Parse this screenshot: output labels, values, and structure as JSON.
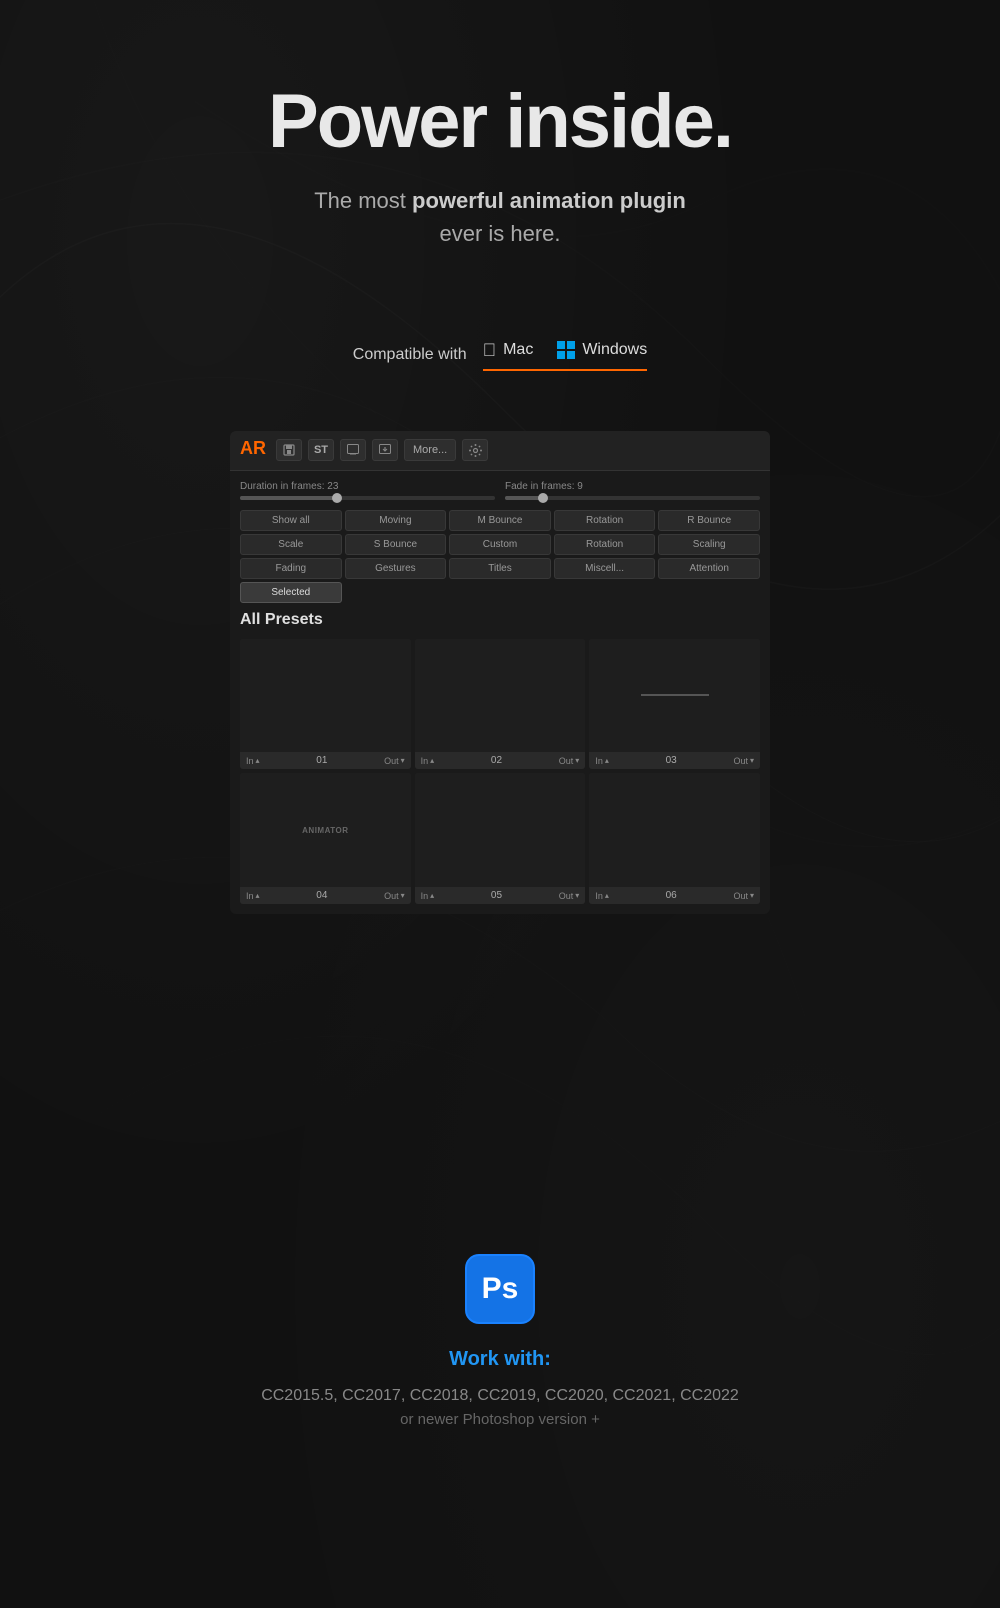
{
  "hero": {
    "title": "Power inside.",
    "subtitle_line1": "The most",
    "subtitle_bold": "powerful animation plugin",
    "subtitle_line2": "ever is here."
  },
  "compatible": {
    "label": "Compatible with",
    "mac": "Mac",
    "windows": "Windows"
  },
  "panel": {
    "toolbar": {
      "logo_text": "AR",
      "btn_st": "ST",
      "btn_more": "More...",
      "btn_gear": "⚙"
    },
    "duration_label": "Duration in frames: 23",
    "fade_label": "Fade in frames: 9",
    "duration_value": 23,
    "duration_max": 60,
    "fade_value": 9,
    "fade_max": 60,
    "filters": [
      {
        "label": "Show all",
        "active": false
      },
      {
        "label": "Moving",
        "active": false
      },
      {
        "label": "M Bounce",
        "active": false
      },
      {
        "label": "Rotation",
        "active": false
      },
      {
        "label": "R Bounce",
        "active": false
      },
      {
        "label": "Scale",
        "active": false
      },
      {
        "label": "S Bounce",
        "active": false
      },
      {
        "label": "Custom",
        "active": false
      },
      {
        "label": "Rotation",
        "active": false
      },
      {
        "label": "Scaling",
        "active": false
      },
      {
        "label": "Fading",
        "active": false
      },
      {
        "label": "Gestures",
        "active": false
      },
      {
        "label": "Titles",
        "active": false
      },
      {
        "label": "Miscell...",
        "active": false
      },
      {
        "label": "Attention",
        "active": false
      },
      {
        "label": "Selected",
        "active": true
      }
    ],
    "section_title": "All Presets",
    "presets": [
      {
        "number": "01",
        "has_line": false
      },
      {
        "number": "02",
        "has_line": false
      },
      {
        "number": "03",
        "has_line": true
      },
      {
        "number": "04",
        "has_line": false,
        "label": "ANIMATOR"
      },
      {
        "number": "05",
        "has_line": false
      },
      {
        "number": "06",
        "has_line": false
      }
    ]
  },
  "bottom": {
    "ps_label": "Ps",
    "work_with": "Work with:",
    "versions": "CC2015.5, CC2017, CC2018, CC2019, CC2020, CC2021, CC2022",
    "versions_sub": "or newer Photoshop version +"
  }
}
